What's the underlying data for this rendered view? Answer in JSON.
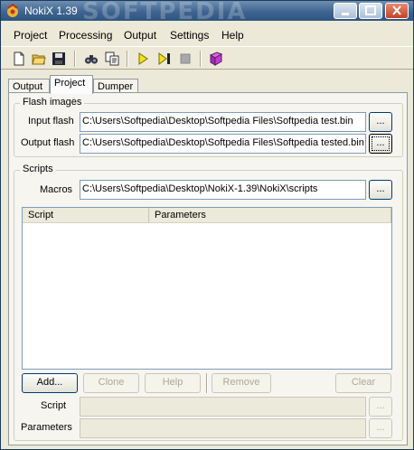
{
  "window": {
    "title": "NokiX 1.39",
    "watermark": "SOFTPEDIA"
  },
  "menu": [
    "Project",
    "Processing",
    "Output",
    "Settings",
    "Help"
  ],
  "toolbar": {
    "icons": [
      "new-file-icon",
      "open-folder-icon",
      "save-icon",
      "find-icon",
      "copy-icon",
      "play-icon",
      "step-play-icon",
      "stop-icon",
      "book-icon"
    ]
  },
  "tabs": [
    "Output",
    "Project",
    "Dumper"
  ],
  "active_tab": "Project",
  "flash_images": {
    "title": "Flash images",
    "input_label": "Input flash",
    "input_value": "C:\\Users\\Softpedia\\Desktop\\Softpedia Files\\Softpedia test.bin",
    "output_label": "Output flash",
    "output_value": "C:\\Users\\Softpedia\\Desktop\\Softpedia Files\\Softpedia tested.bin",
    "browse_label": "..."
  },
  "scripts": {
    "title": "Scripts",
    "macros_label": "Macros",
    "macros_value": "C:\\Users\\Softpedia\\Desktop\\NokiX-1.39\\NokiX\\scripts",
    "columns": [
      "Script",
      "Parameters"
    ],
    "buttons": {
      "add": "Add...",
      "clone": "Clone",
      "help": "Help",
      "remove": "Remove",
      "clear": "Clear"
    },
    "script_label": "Script",
    "parameters_label": "Parameters",
    "browse_label": "..."
  }
}
